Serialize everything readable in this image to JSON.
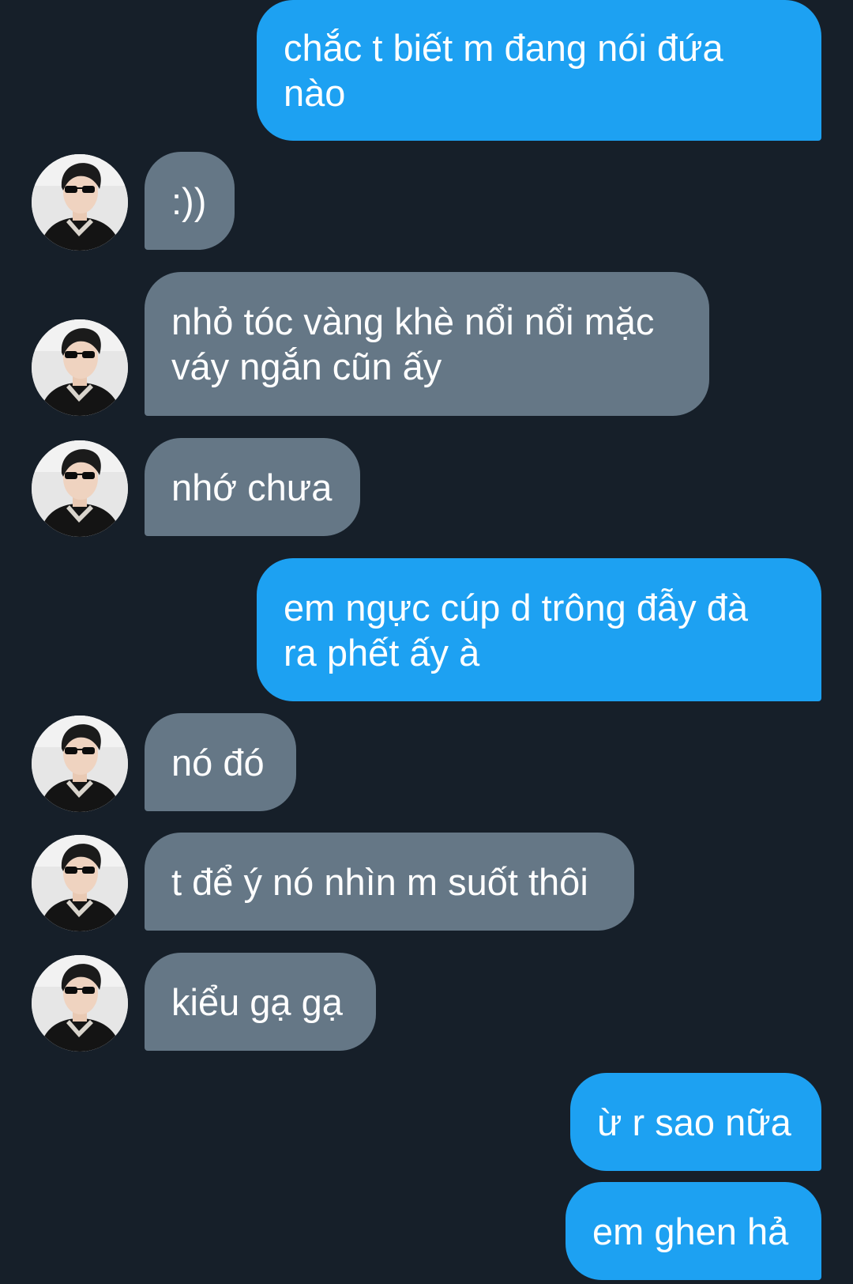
{
  "conversation": {
    "messages": [
      {
        "sender": "me",
        "text": "chắc t biết m đang nói đứa\nnào"
      },
      {
        "sender": "them",
        "text": ":))"
      },
      {
        "sender": "them",
        "text": "nhỏ tóc vàng khè nổi nổi mặc\nváy ngắn cũn ấy"
      },
      {
        "sender": "them",
        "text": "nhớ chưa"
      },
      {
        "sender": "me",
        "text": "em ngực cúp d trông đẫy đà\nra phết ấy à"
      },
      {
        "sender": "them",
        "text": "nó đó"
      },
      {
        "sender": "them",
        "text": "t để ý nó nhìn m suốt thôi"
      },
      {
        "sender": "them",
        "text": "kiểu gạ gạ"
      },
      {
        "sender": "me",
        "text": "ừ r sao nữa"
      },
      {
        "sender": "me",
        "text": "em ghen hả"
      }
    ]
  },
  "colors": {
    "background": "#161f29",
    "sent_bubble": "#1da1f2",
    "received_bubble": "#657786"
  },
  "icons": {
    "avatar": "contact-avatar-photo"
  }
}
